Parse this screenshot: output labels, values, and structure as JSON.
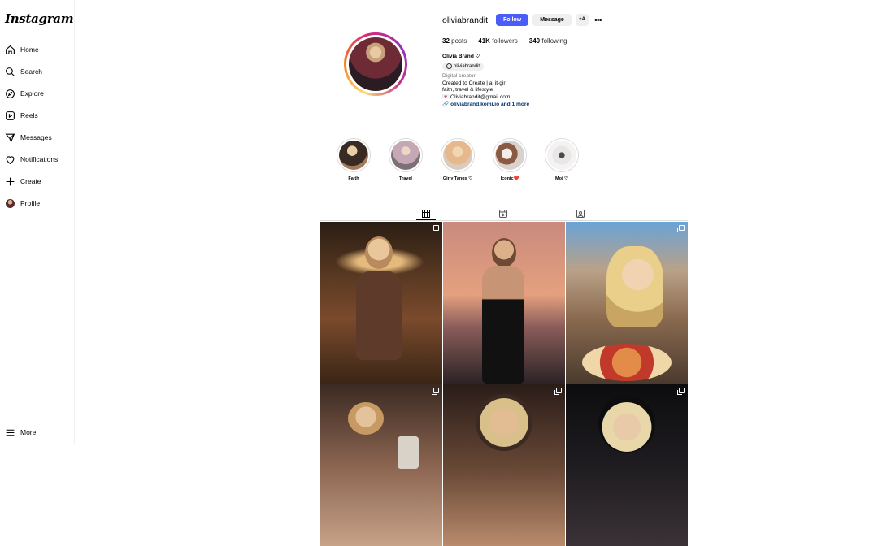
{
  "app": {
    "logo": "Instagram"
  },
  "sidebar": {
    "items": [
      {
        "label": "Home",
        "icon": "home-icon"
      },
      {
        "label": "Search",
        "icon": "search-icon"
      },
      {
        "label": "Explore",
        "icon": "compass-icon"
      },
      {
        "label": "Reels",
        "icon": "reels-icon"
      },
      {
        "label": "Messages",
        "icon": "messages-icon"
      },
      {
        "label": "Notifications",
        "icon": "heart-icon"
      },
      {
        "label": "Create",
        "icon": "plus-icon"
      },
      {
        "label": "Profile",
        "icon": "avatar-icon"
      }
    ],
    "more": {
      "label": "More",
      "icon": "hamburger-icon"
    }
  },
  "profile": {
    "username": "oliviabrandit",
    "follow_label": "Follow",
    "message_label": "Message",
    "add_label": "+A",
    "more_label": "•••",
    "stats": {
      "posts_count": "32",
      "posts_label": "posts",
      "followers_count": "41K",
      "followers_label": "followers",
      "following_count": "340",
      "following_label": "following"
    },
    "full_name": "Olivia Brand ♡",
    "threads_handle": "oliviabrandit",
    "category": "Digital creator",
    "bio_lines": [
      "Created to Create | ai it-girl",
      "faith, travel & lifestyle",
      "💌 Oliviabrandit@gmail.com"
    ],
    "link": "oliviabrand.komi.io and 1 more"
  },
  "highlights": [
    {
      "label": "Faith"
    },
    {
      "label": "Travel"
    },
    {
      "label": "Girly Tangs ♡"
    },
    {
      "label": "Iconic❤️"
    },
    {
      "label": "Moi ♡"
    }
  ],
  "tabs": [
    {
      "name": "posts",
      "icon": "grid-icon",
      "active": true
    },
    {
      "name": "reels",
      "icon": "reels-icon",
      "active": false
    },
    {
      "name": "tagged",
      "icon": "tagged-icon",
      "active": false
    }
  ],
  "posts": [
    {
      "multi": true
    },
    {
      "multi": false
    },
    {
      "multi": true
    },
    {
      "multi": true
    },
    {
      "multi": true
    },
    {
      "multi": true
    }
  ],
  "colors": {
    "follow_button": "#4a5df9",
    "link": "#00376b"
  }
}
